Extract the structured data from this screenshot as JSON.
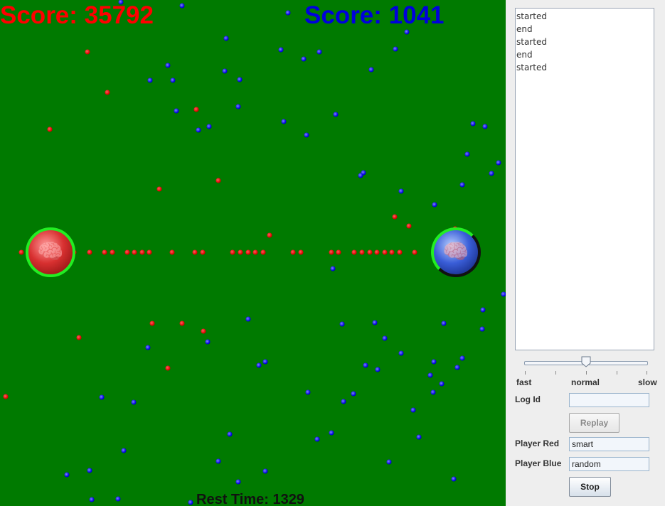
{
  "game": {
    "score_red": "Score: 35792",
    "score_blue": "Score: 1041",
    "rest_time": "Rest Time: 1329",
    "colors": {
      "field": "#007a00",
      "red_team": "#ff0000",
      "blue_team": "#0000dd",
      "base_ring": "#22ee22"
    },
    "icons": {
      "red_base": "red-brain-icon",
      "blue_base": "blue-brain-icon"
    }
  },
  "sidebar": {
    "log_lines": [
      "started",
      "end",
      "started",
      "end",
      "started"
    ],
    "speed": {
      "label_fast": "fast",
      "label_normal": "normal",
      "label_slow": "slow",
      "value": "normal"
    },
    "log_id": {
      "label": "Log Id",
      "value": ""
    },
    "replay_label": "Replay",
    "player_red": {
      "label": "Player Red",
      "value": "smart"
    },
    "player_blue": {
      "label": "Player Blue",
      "value": "random"
    },
    "stop_label": "Stop"
  }
}
